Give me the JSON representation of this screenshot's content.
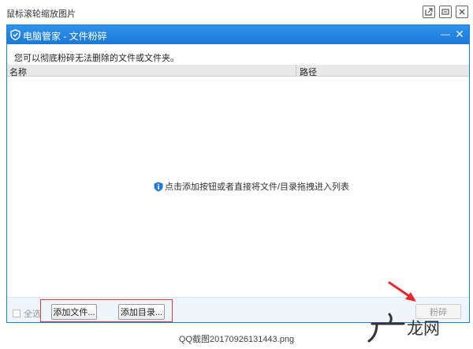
{
  "viewer": {
    "title": "鼠标滚轮缩放图片",
    "filename": "QQ截图20170926131443.png",
    "buttons": [
      "open-external-icon",
      "minimize-icon",
      "close-icon"
    ]
  },
  "app": {
    "title": "电脑管家 - 文件粉碎",
    "min_glyph": "—",
    "close_glyph": "✕",
    "accent_color": "#1b78d6"
  },
  "main": {
    "description": "您可以彻底粉碎无法删除的文件或文件夹。",
    "columns": [
      "名称",
      "路径"
    ],
    "empty_hint": "点击添加按钮或者直接将文件/目录拖拽进入列表"
  },
  "footer": {
    "select_all": "全选",
    "add_file": "添加文件...",
    "add_dir": "添加目录...",
    "shred": "粉碎"
  },
  "watermark": {
    "text": "龙网"
  }
}
